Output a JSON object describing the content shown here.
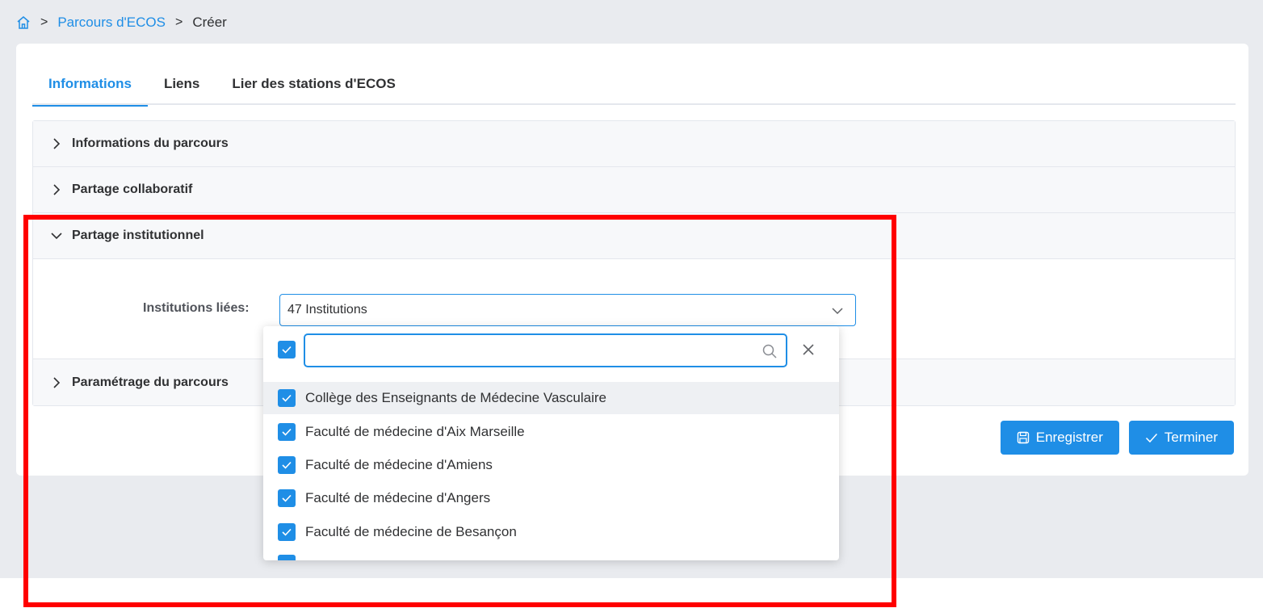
{
  "breadcrumb": {
    "home_icon": "home-icon",
    "link": "Parcours d'ECOS",
    "current": "Créer"
  },
  "tabs": [
    {
      "label": "Informations",
      "active": true
    },
    {
      "label": "Liens",
      "active": false
    },
    {
      "label": "Lier des stations d'ECOS",
      "active": false
    }
  ],
  "sections": {
    "info": "Informations du parcours",
    "collab": "Partage collaboratif",
    "institutionnel": "Partage institutionnel",
    "parametrage": "Paramétrage du parcours"
  },
  "form": {
    "institutions_label": "Institutions liées:",
    "institutions_value": "47 Institutions"
  },
  "dropdown": {
    "search_value": "",
    "options": [
      "Collège des Enseignants de Médecine Vasculaire",
      "Faculté de médecine d'Aix Marseille",
      "Faculté de médecine d'Amiens",
      "Faculté de médecine d'Angers",
      "Faculté de médecine de Besançon",
      ""
    ]
  },
  "actions": {
    "save": "Enregistrer",
    "finish": "Terminer"
  },
  "colors": {
    "accent": "#1f8ee6",
    "highlight_border": "#ff0000",
    "page_bg": "#e9ebef"
  }
}
